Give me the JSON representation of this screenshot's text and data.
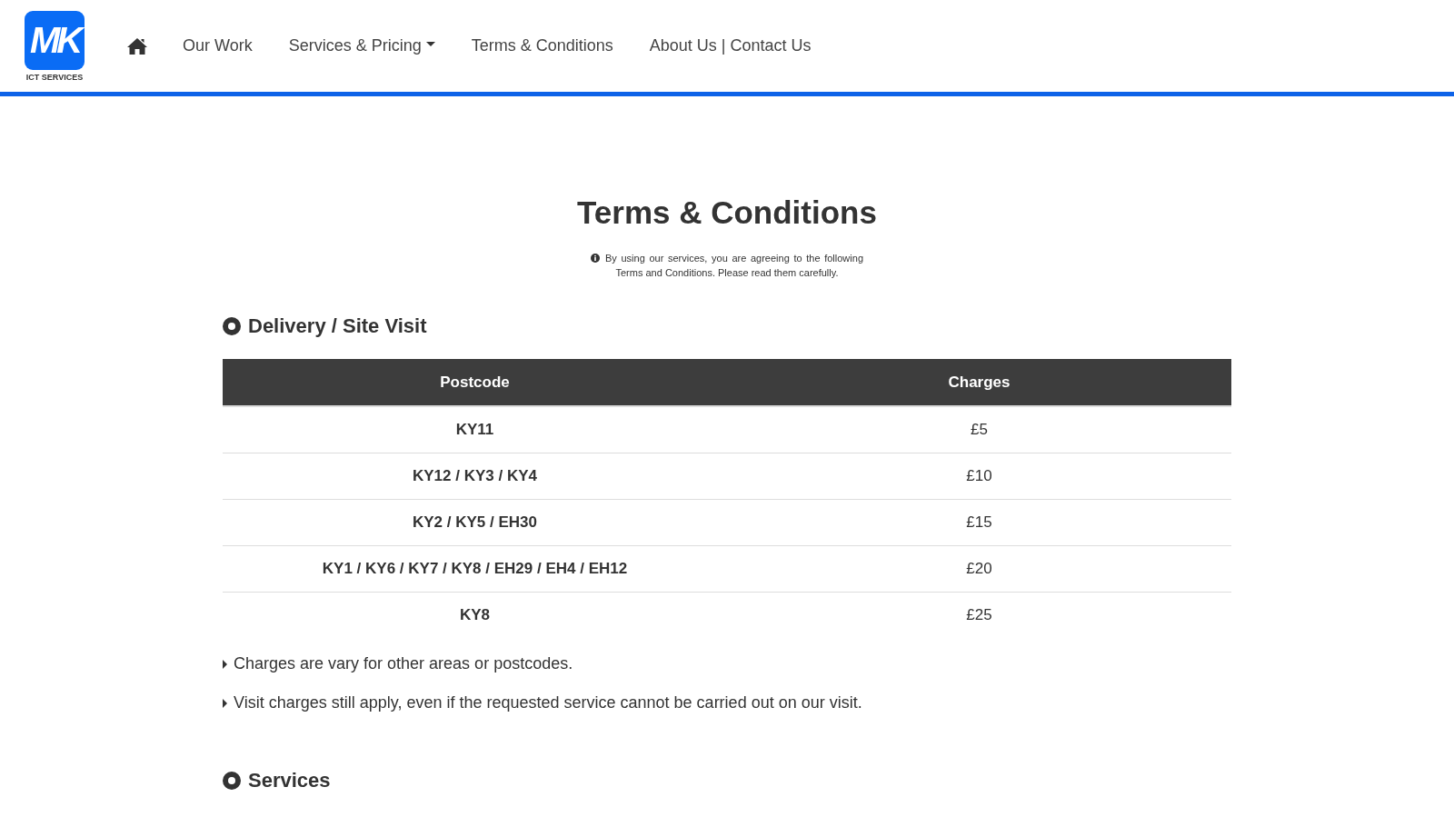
{
  "logo": {
    "mark": "MK",
    "caption": "ICT SERVICES"
  },
  "nav": [
    {
      "label": "Our Work",
      "dropdown": false
    },
    {
      "label": "Services & Pricing",
      "dropdown": true
    },
    {
      "label": "Terms & Conditions",
      "dropdown": false
    },
    {
      "label": "About Us | Contact Us",
      "dropdown": false
    }
  ],
  "title": "Terms & Conditions",
  "notice": "By using our services, you are agreeing to the following Terms and Conditions. Please read them carefully.",
  "sections": [
    {
      "heading": "Delivery / Site Visit",
      "table": {
        "columns": [
          "Postcode",
          "Charges"
        ],
        "rows": [
          [
            "KY11",
            "£5"
          ],
          [
            "KY12 / KY3 / KY4",
            "£10"
          ],
          [
            "KY2 / KY5 / EH30",
            "£15"
          ],
          [
            "KY1 / KY6 / KY7 / KY8 / EH29 / EH4 / EH12",
            "£20"
          ],
          [
            "KY8",
            "£25"
          ]
        ]
      },
      "notes": [
        "Charges are vary for other areas or postcodes.",
        "Visit charges still apply, even if the requested service cannot be carried out on our visit."
      ]
    },
    {
      "heading": "Services"
    }
  ]
}
